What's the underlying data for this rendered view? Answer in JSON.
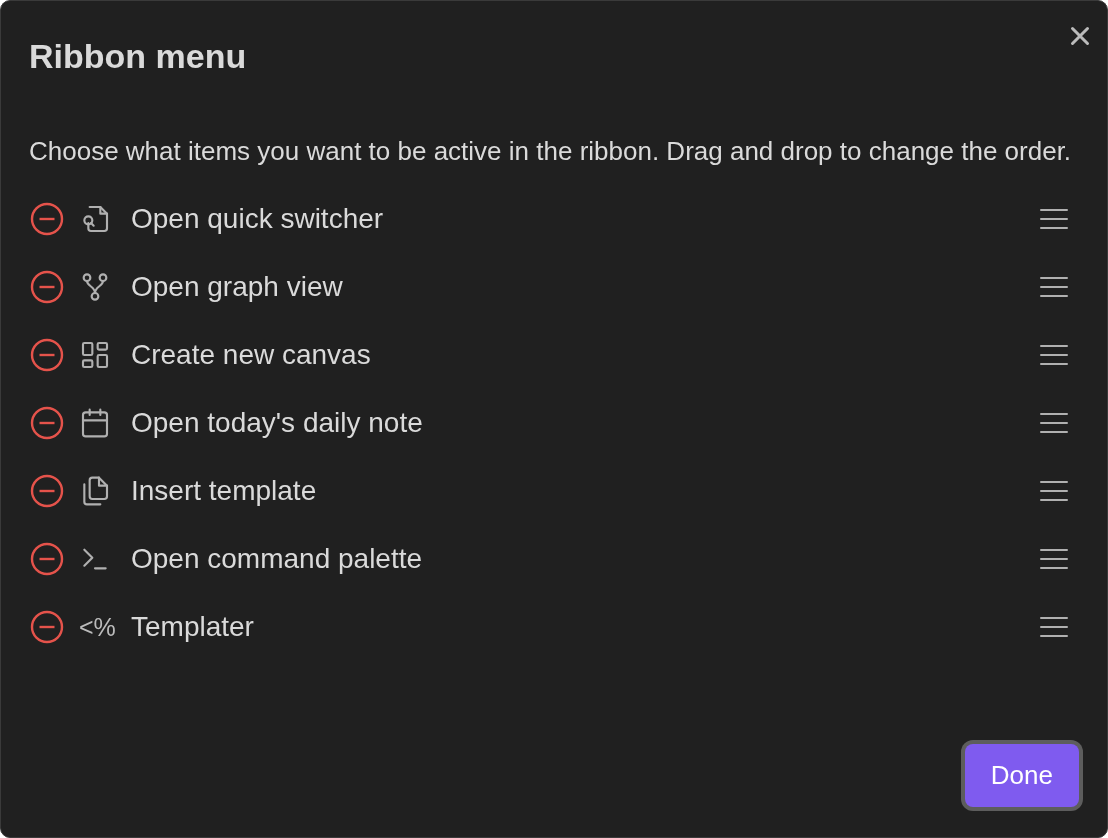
{
  "dialog": {
    "title": "Ribbon menu",
    "description": "Choose what items you want to be active in the ribbon. Drag and drop to change the order."
  },
  "items": [
    {
      "label": "Open quick switcher",
      "kind": "icon"
    },
    {
      "label": "Open graph view",
      "kind": "icon"
    },
    {
      "label": "Create new canvas",
      "kind": "icon"
    },
    {
      "label": "Open today's daily note",
      "kind": "icon"
    },
    {
      "label": "Insert template",
      "kind": "icon"
    },
    {
      "label": "Open command palette",
      "kind": "icon"
    },
    {
      "label": "Templater",
      "kind": "glyph",
      "glyph": "<%"
    }
  ],
  "buttons": {
    "primary": "Done"
  }
}
